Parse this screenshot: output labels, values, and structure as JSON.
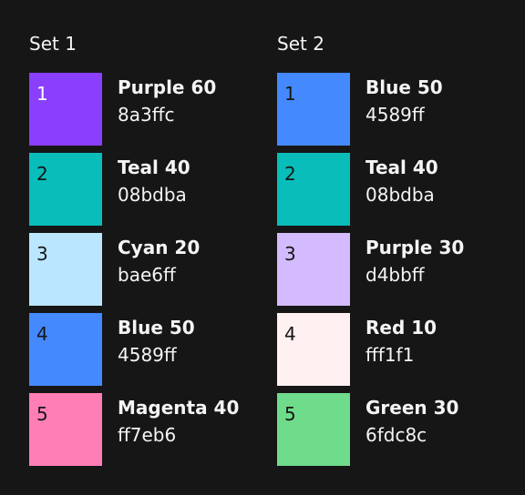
{
  "sets": [
    {
      "title": "Set 1",
      "items": [
        {
          "number": "1",
          "name": "Purple 60",
          "hex": "8a3ffc",
          "color": "#8a3ffc",
          "number_color": "#ffffff"
        },
        {
          "number": "2",
          "name": "Teal 40",
          "hex": "08bdba",
          "color": "#08bdba",
          "number_color": "#161616"
        },
        {
          "number": "3",
          "name": "Cyan 20",
          "hex": "bae6ff",
          "color": "#bae6ff",
          "number_color": "#161616"
        },
        {
          "number": "4",
          "name": "Blue 50",
          "hex": "4589ff",
          "color": "#4589ff",
          "number_color": "#161616"
        },
        {
          "number": "5",
          "name": "Magenta 40",
          "hex": "ff7eb6",
          "color": "#ff7eb6",
          "number_color": "#161616"
        }
      ]
    },
    {
      "title": "Set 2",
      "items": [
        {
          "number": "1",
          "name": "Blue 50",
          "hex": "4589ff",
          "color": "#4589ff",
          "number_color": "#161616"
        },
        {
          "number": "2",
          "name": "Teal 40",
          "hex": "08bdba",
          "color": "#08bdba",
          "number_color": "#161616"
        },
        {
          "number": "3",
          "name": "Purple 30",
          "hex": "d4bbff",
          "color": "#d4bbff",
          "number_color": "#161616"
        },
        {
          "number": "4",
          "name": "Red 10",
          "hex": "fff1f1",
          "color": "#fff1f1",
          "number_color": "#161616"
        },
        {
          "number": "5",
          "name": "Green 30",
          "hex": "6fdc8c",
          "color": "#6fdc8c",
          "number_color": "#161616"
        }
      ]
    }
  ]
}
